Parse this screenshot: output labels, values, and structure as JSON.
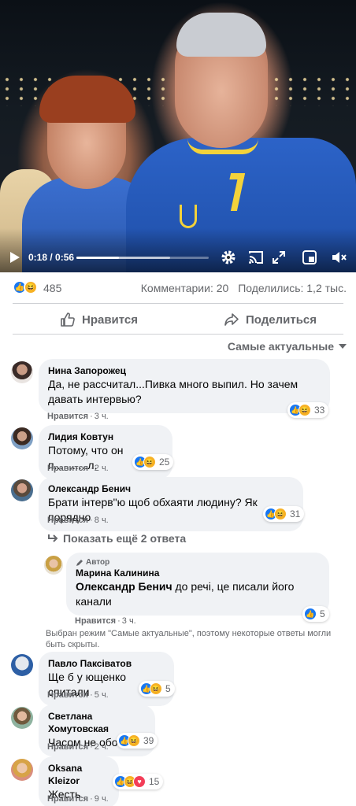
{
  "video": {
    "time": "0:18 / 0:56",
    "progress_fraction": 0.32,
    "buffer_fraction": 0.71,
    "icons": [
      "play-icon",
      "gear-icon",
      "cast-icon",
      "expand-icon",
      "pip-icon",
      "volume-icon"
    ]
  },
  "post": {
    "reaction_count": "485",
    "comments": "Комментарии: 20",
    "shares": "Поделились: 1,2 тыс."
  },
  "actions": {
    "like": "Нравится",
    "share": "Поделиться"
  },
  "sort_label": "Самые актуальные",
  "colors": {
    "fb_blue": "#1877f2",
    "bubble_bg": "#f0f2f5",
    "muted": "#65676b"
  },
  "comments": [
    {
      "author": "Нина Запорожец",
      "text": "Да, не рассчитал...Пивка много выпил. Но зачем давать интервью?",
      "like": "Нравится",
      "time": "3 ч.",
      "reactions": "33"
    },
    {
      "author": "Лидия Ковтун",
      "text": "Потому, что он п...........л.",
      "like": "Нравится",
      "time": "2 ч.",
      "reactions": "25"
    },
    {
      "author": "Олександр Бенич",
      "text": "Брати інтерв\"ю щоб обхаяти людину? Як порядно",
      "like": "Нравится",
      "time": "8 ч.",
      "reactions": "31"
    }
  ],
  "more_replies": "Показать ещё 2 ответа",
  "reply": {
    "badge": "Автор",
    "author": "Марина Калинина",
    "mention": "Олександр Бенич",
    "text": " до речі, це писали його канали",
    "like": "Нравится",
    "time": "3 ч.",
    "reactions": "5"
  },
  "notice": "Выбран режим \"Самые актуальные\", поэтому некоторые ответы могли быть скрыты.",
  "comments2": [
    {
      "author": "Павло Паксіватов",
      "text": "Ще б у ющенко спитали",
      "like": "Нравится",
      "time": "5 ч.",
      "reactions": "5"
    },
    {
      "author": "Светлана Хомутовская",
      "text": "Часом не обоє?",
      "like": "Нравится",
      "time": "2 ч.",
      "reactions": "39"
    },
    {
      "author": "Oksana Kleizor",
      "text": "Жесть",
      "like": "Нравится",
      "time": "9 ч.",
      "reactions": "15"
    }
  ]
}
